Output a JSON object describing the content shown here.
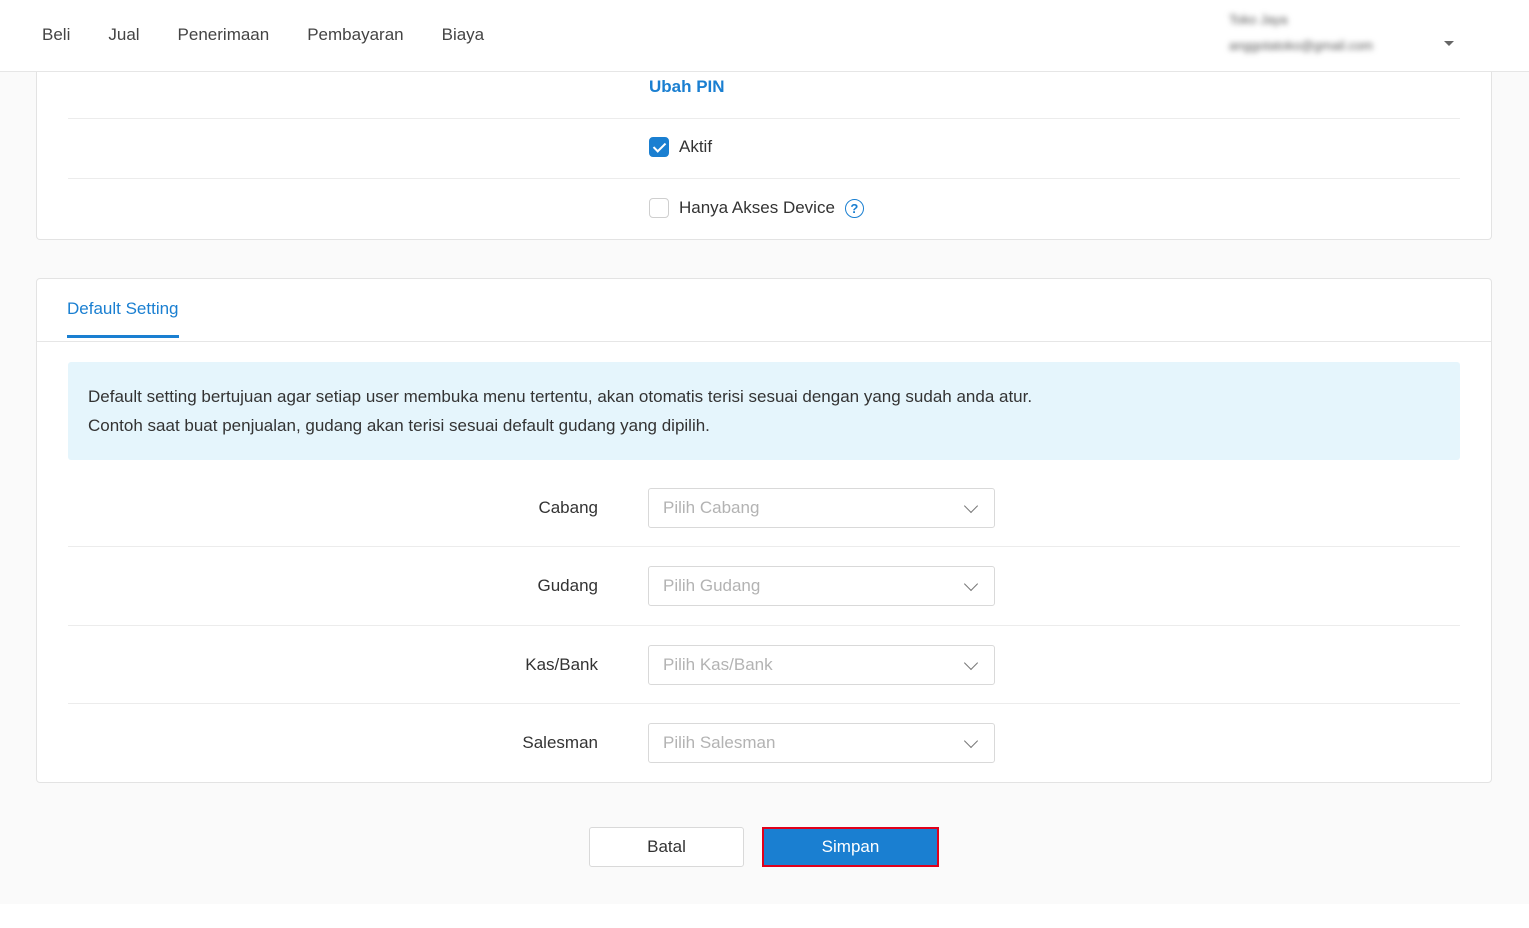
{
  "nav": {
    "items": [
      {
        "label": "Beli"
      },
      {
        "label": "Jual"
      },
      {
        "label": "Penerimaan"
      },
      {
        "label": "Pembayaran"
      },
      {
        "label": "Biaya"
      }
    ]
  },
  "user": {
    "name": "Toko Jaya",
    "email": "anggotatoko@gmail.com"
  },
  "account": {
    "change_pin": "Ubah PIN",
    "active_label": "Aktif",
    "active_checked": true,
    "device_only_label": "Hanya Akses Device",
    "device_only_checked": false
  },
  "default_setting": {
    "tab_label": "Default Setting",
    "info_line1": "Default setting bertujuan agar setiap user membuka menu tertentu, akan otomatis terisi sesuai dengan yang sudah anda atur.",
    "info_line2": "Contoh saat buat penjualan, gudang akan terisi sesuai default gudang yang dipilih.",
    "fields": [
      {
        "label": "Cabang",
        "placeholder": "Pilih Cabang"
      },
      {
        "label": "Gudang",
        "placeholder": "Pilih Gudang"
      },
      {
        "label": "Kas/Bank",
        "placeholder": "Pilih Kas/Bank"
      },
      {
        "label": "Salesman",
        "placeholder": "Pilih Salesman"
      }
    ]
  },
  "actions": {
    "cancel_label": "Batal",
    "save_label": "Simpan"
  },
  "colors": {
    "accent": "#1a7fd1",
    "info_bg": "#e5f5fc",
    "highlight_border": "#e0001b"
  }
}
